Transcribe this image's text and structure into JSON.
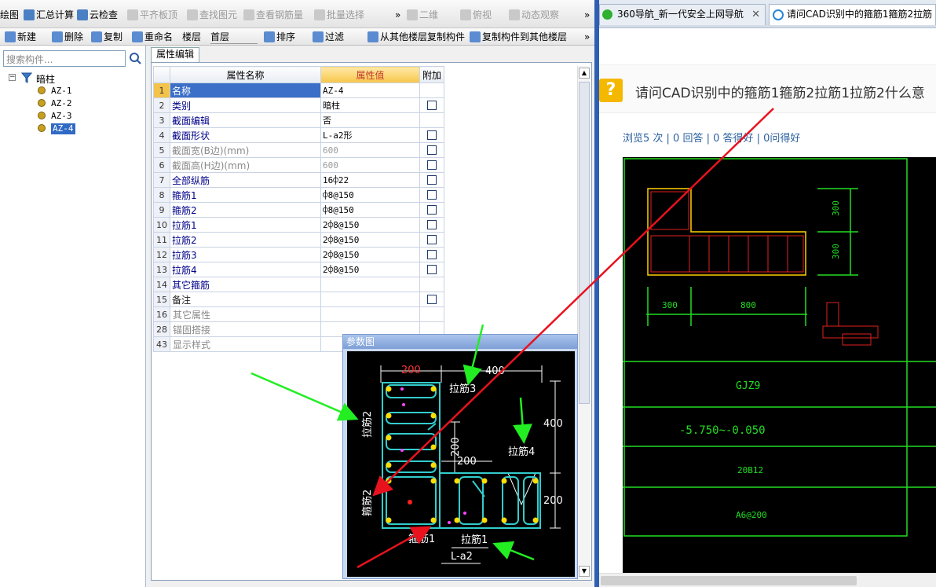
{
  "toolbar1": {
    "items": [
      {
        "label": "绘图",
        "icon": "drawing-icon",
        "disabled": false
      },
      {
        "label": "汇总计算",
        "icon": "sigma-icon",
        "disabled": false
      },
      {
        "label": "云检查",
        "icon": "cloud-check-icon",
        "disabled": false
      },
      {
        "label": "平齐板顶",
        "icon": "align-slab-icon",
        "disabled": true
      },
      {
        "label": "查找图元",
        "icon": "find-element-icon",
        "disabled": true
      },
      {
        "label": "查看钢筋量",
        "icon": "view-rebar-icon",
        "disabled": true
      },
      {
        "label": "批量选择",
        "icon": "batch-select-icon",
        "disabled": true
      },
      {
        "label": "二维",
        "icon": "2d-icon",
        "disabled": true
      },
      {
        "label": "俯视",
        "icon": "top-view-icon",
        "disabled": true
      },
      {
        "label": "动态观察",
        "icon": "orbit-icon",
        "disabled": true
      }
    ],
    "overflow": "»"
  },
  "toolbar2": {
    "items": [
      {
        "label": "新建",
        "icon": "new-icon"
      },
      {
        "label": "删除",
        "icon": "delete-icon"
      },
      {
        "label": "复制",
        "icon": "copy-icon"
      },
      {
        "label": "重命名",
        "icon": "rename-icon"
      },
      {
        "label": "楼层",
        "icon": ""
      },
      {
        "label": "首层",
        "icon": ""
      },
      {
        "label": "排序",
        "icon": "sort-icon"
      },
      {
        "label": "过滤",
        "icon": "filter-icon"
      },
      {
        "label": "从其他楼层复制构件",
        "icon": "copy-from-floor-icon"
      },
      {
        "label": "复制构件到其他楼层",
        "icon": "copy-to-floor-icon"
      }
    ],
    "overflow": "»"
  },
  "tree": {
    "search_placeholder": "搜索构件...",
    "root": "暗柱",
    "children": [
      "AZ-1",
      "AZ-2",
      "AZ-3",
      "AZ-4"
    ],
    "selected": "AZ-4"
  },
  "property_tab": "属性编辑",
  "grid": {
    "headers": {
      "name": "属性名称",
      "value": "属性值",
      "extra": "附加"
    },
    "rows": [
      {
        "num": "1",
        "name": "名称",
        "value": "AZ-4",
        "cb": false,
        "style": "sel"
      },
      {
        "num": "2",
        "name": "类别",
        "value": "暗柱",
        "cb": true,
        "style": ""
      },
      {
        "num": "3",
        "name": "截面编辑",
        "value": "否",
        "cb": false,
        "style": ""
      },
      {
        "num": "4",
        "name": "截面形状",
        "value": "L-a2形",
        "cb": true,
        "style": ""
      },
      {
        "num": "5",
        "name": "截面宽(B边)(mm)",
        "value": "600",
        "cb": true,
        "style": "gray"
      },
      {
        "num": "6",
        "name": "截面高(H边)(mm)",
        "value": "600",
        "cb": true,
        "style": "gray"
      },
      {
        "num": "7",
        "name": "全部纵筋",
        "value": "16⌽22",
        "cb": true,
        "style": ""
      },
      {
        "num": "8",
        "name": "箍筋1",
        "value": "⌽8@150",
        "cb": true,
        "style": ""
      },
      {
        "num": "9",
        "name": "箍筋2",
        "value": "⌽8@150",
        "cb": true,
        "style": ""
      },
      {
        "num": "10",
        "name": "拉筋1",
        "value": "2⌽8@150",
        "cb": true,
        "style": ""
      },
      {
        "num": "11",
        "name": "拉筋2",
        "value": "2⌽8@150",
        "cb": true,
        "style": ""
      },
      {
        "num": "12",
        "name": "拉筋3",
        "value": "2⌽8@150",
        "cb": true,
        "style": ""
      },
      {
        "num": "13",
        "name": "拉筋4",
        "value": "2⌽8@150",
        "cb": true,
        "style": ""
      },
      {
        "num": "14",
        "name": "其它箍筋",
        "value": "",
        "cb": false,
        "style": ""
      },
      {
        "num": "15",
        "name": "备注",
        "value": "",
        "cb": true,
        "style": "blk"
      },
      {
        "num": "16",
        "name": "其它属性",
        "value": "",
        "cb": false,
        "style": "group"
      },
      {
        "num": "28",
        "name": "锚固搭接",
        "value": "",
        "cb": false,
        "style": "group"
      },
      {
        "num": "43",
        "name": "显示样式",
        "value": "",
        "cb": false,
        "style": "group"
      }
    ]
  },
  "param_panel": {
    "title": "参数图",
    "dims": {
      "w1": "200",
      "w2": "400",
      "h_right": "400",
      "h_mid": "200",
      "w_mid": "200",
      "h_bottom": "200"
    },
    "labels": {
      "tie3": "拉筋3",
      "tie2a": "拉筋2",
      "tie2b": "箍筋2",
      "tie4": "拉筋4",
      "stir1": "箍筋1",
      "tie1": "拉筋1",
      "shape": "L-a2"
    }
  },
  "browser": {
    "tabs": [
      {
        "title": "360导航_新一代安全上网导航",
        "active": false
      },
      {
        "title": "请问CAD识别中的箍筋1箍筋2拉筋",
        "active": true
      }
    ],
    "question_title": "请问CAD识别中的箍筋1箍筋2拉筋1拉筋2什么意",
    "stats": "浏览5 次 | 0 回答 | 0 答得好 | 0问得好",
    "cad": {
      "dim_300a": "300",
      "dim_300b": "300",
      "dim_300w": "300",
      "dim_800": "800",
      "name": "GJZ9",
      "elev": "-5.750~-0.050",
      "rebar": "20B12",
      "stirrup": "A6@200"
    }
  },
  "colors": {
    "accent": "#2f5fb3",
    "selected_row": "#3c6fc7",
    "header_val": "#f7c64a",
    "cad_cyan": "#33cccc",
    "cad_green": "#22dd22",
    "arrow_red": "#e8121e",
    "arrow_green": "#22ee22"
  }
}
